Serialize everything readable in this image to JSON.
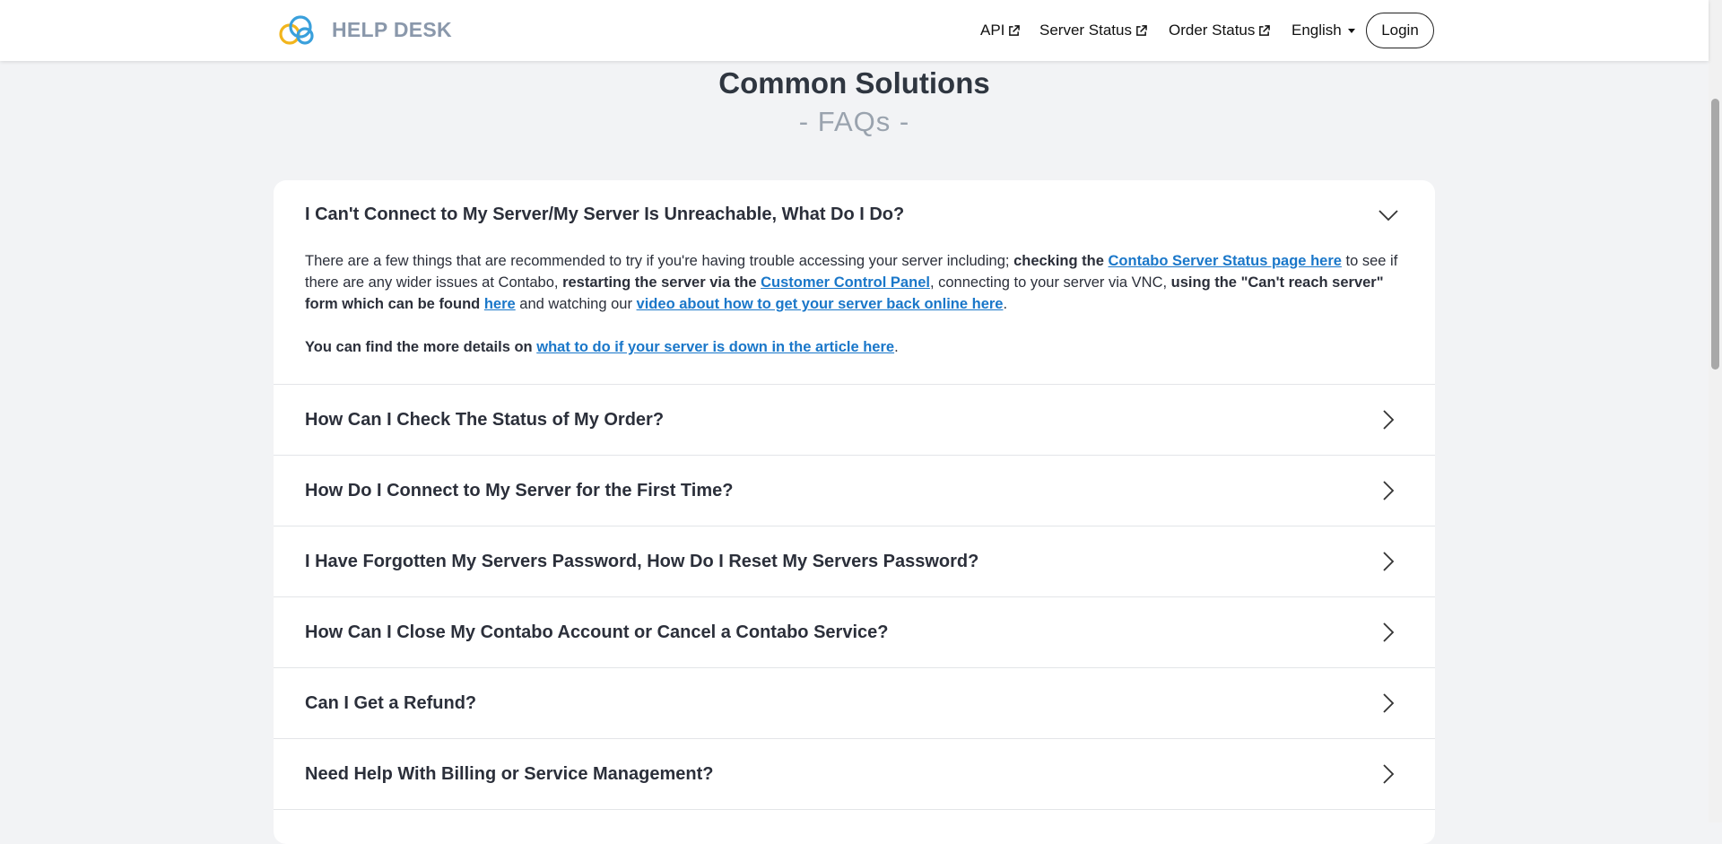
{
  "header": {
    "brand": "HELP DESK",
    "nav": {
      "api": "API",
      "server_status": "Server Status",
      "order_status": "Order Status",
      "language": "English"
    },
    "login": "Login"
  },
  "page": {
    "title": "Common Solutions",
    "subtitle": "- FAQs -"
  },
  "faq": {
    "open": {
      "question": "I Can't Connect to My Server/My Server Is Unreachable, What Do I Do?",
      "p1": {
        "t1": "There are a few things that are recommended to try if you're having trouble accessing your server including; ",
        "b1": "checking the ",
        "l1": "Contabo Server Status page here",
        "t2": " to see if there are any wider issues at Contabo, ",
        "b2": "restarting the server via the ",
        "l2": "Customer Control Panel",
        "t3": ", connecting to your server via VNC, ",
        "b3": "using the \"Can't reach server\" form which can be found ",
        "l3": "here",
        "t4": " and watching our ",
        "l4": "video about how to get your server back online here",
        "t5": "."
      },
      "p2": {
        "b1": "You can find the more details on ",
        "l1": "what to do if your server is down in the article here",
        "t1": "."
      }
    },
    "items": [
      "How Can I Check The Status of My Order?",
      "How Do I Connect to My Server for the First Time?",
      "I Have Forgotten My Servers Password, How Do I Reset My Servers Password?",
      "How Can I Close My Contabo Account or Cancel a Contabo Service?",
      "Can I Get a Refund?",
      "Need Help With Billing or Service Management?"
    ]
  },
  "icons": {
    "logo": "cloud-logo-icon",
    "external": "external-link-icon",
    "expanded": "chevron-down-icon",
    "collapsed": "chevron-right-icon"
  },
  "colors": {
    "link": "#1a77c9",
    "brand_text": "#8a98ab",
    "logo_blue": "#3aa0dc",
    "logo_yellow": "#f2b51c"
  }
}
